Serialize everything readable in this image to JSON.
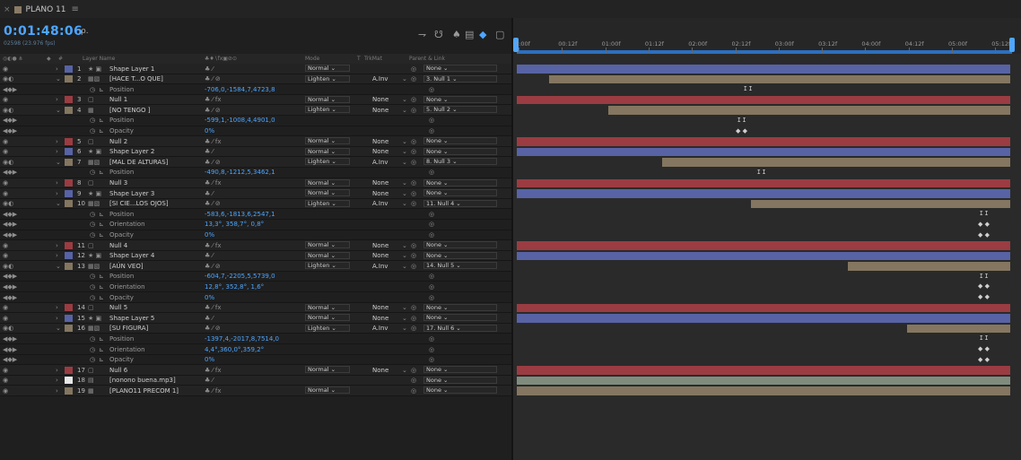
{
  "tab": {
    "close": "×",
    "name": "PLANO 11",
    "menu": "≡"
  },
  "timecode": "0:01:48:06",
  "frameinfo": "02598 (23.976 fps)",
  "search_icon": "ρ.",
  "columns": {
    "name": "Layer Name",
    "mode": "Mode",
    "t": "T",
    "trkmat": "TrkMat",
    "parent": "Parent & Link",
    "num": "#"
  },
  "ruler": [
    "0:00f",
    "00:12f",
    "01:00f",
    "01:12f",
    "02:00f",
    "02:12f",
    "03:00f",
    "03:12f",
    "04:00f",
    "04:12f",
    "05:00f",
    "05:12f"
  ],
  "colors": {
    "red": "#9b3c42",
    "blue": "#5763a5",
    "tan": "#847660",
    "gray": "#7a7a7a",
    "sage": "#7f8c7d",
    "white": "#e8e8e8",
    "accent": "#4da6ff"
  },
  "rows": [
    {
      "type": "layer",
      "num": "1",
      "lcolor": "#5763a5",
      "icon": "★ ▣",
      "name": "Shape Layer 1",
      "sw": "♣ ⁄",
      "mode": "Normal",
      "t": "",
      "trk": "",
      "parent": "None",
      "bar": "blue",
      "bs": 0
    },
    {
      "type": "layer",
      "num": "2",
      "lcolor": "#847660",
      "icon": "▦▧",
      "name": "[HACE T...O QUE]",
      "sw": "♣   ⁄         ⊘",
      "mode": "Lighten",
      "t": "",
      "trk": "A.Inv",
      "parent": "3. Null 1",
      "bar": "tan",
      "bs": 6.5,
      "exp": true
    },
    {
      "type": "prop",
      "name": "Position",
      "value": "-706,0,-1584,7,4723,8",
      "kf": "ⵊ  ⵊ"
    },
    {
      "type": "layer",
      "num": "3",
      "lcolor": "#9b3c42",
      "icon": "▢",
      "name": "Null 1",
      "sw": "♣  ⁄ fx",
      "mode": "Normal",
      "t": "",
      "trk": "None",
      "parent": "None",
      "bar": "red",
      "bs": 0
    },
    {
      "type": "layer",
      "num": "4",
      "lcolor": "#847660",
      "icon": "▦",
      "name": "[NO TENGO ]",
      "sw": "♣   ⁄         ⊘",
      "mode": "Lighten",
      "t": "",
      "trk": "None",
      "parent": "5. Null 2",
      "bar": "tan",
      "bs": 18.5,
      "exp": true
    },
    {
      "type": "prop",
      "name": "Position",
      "value": "-599,1,-1008,4,4901,0",
      "kf": "ⵊ  ⵊ"
    },
    {
      "type": "prop",
      "name": "Opacity",
      "value": "0%",
      "kf": "◆ ◆"
    },
    {
      "type": "layer",
      "num": "5",
      "lcolor": "#9b3c42",
      "icon": "▢",
      "name": "Null 2",
      "sw": "♣  ⁄ fx",
      "mode": "Normal",
      "t": "",
      "trk": "None",
      "parent": "None",
      "bar": "red",
      "bs": 0
    },
    {
      "type": "layer",
      "num": "6",
      "lcolor": "#5763a5",
      "icon": "★ ▣",
      "name": "Shape Layer 2",
      "sw": "♣ ⁄",
      "mode": "Normal",
      "t": "",
      "trk": "None",
      "parent": "None",
      "bar": "blue",
      "bs": 0
    },
    {
      "type": "layer",
      "num": "7",
      "lcolor": "#847660",
      "icon": "▦▧",
      "name": "[MAL DE ALTURAS]",
      "sw": "♣   ⁄         ⊘",
      "mode": "Lighten",
      "t": "",
      "trk": "A.Inv",
      "parent": "8. Null 3",
      "bar": "tan",
      "bs": 29.5,
      "exp": true
    },
    {
      "type": "prop",
      "name": "Position",
      "value": "-490,8,-1212,5,3462,1",
      "kf": "ⵊ  ⵊ"
    },
    {
      "type": "layer",
      "num": "8",
      "lcolor": "#9b3c42",
      "icon": "▢",
      "name": "Null 3",
      "sw": "♣  ⁄ fx",
      "mode": "Normal",
      "t": "",
      "trk": "None",
      "parent": "None",
      "bar": "red",
      "bs": 0
    },
    {
      "type": "layer",
      "num": "9",
      "lcolor": "#5763a5",
      "icon": "★ ▣",
      "name": "Shape Layer 3",
      "sw": "♣ ⁄",
      "mode": "Normal",
      "t": "",
      "trk": "None",
      "parent": "None",
      "bar": "blue",
      "bs": 0
    },
    {
      "type": "layer",
      "num": "10",
      "lcolor": "#847660",
      "icon": "▦▧",
      "name": "[SI CIE...LOS OJOS]",
      "sw": "♣   ⁄         ⊘",
      "mode": "Lighten",
      "t": "",
      "trk": "A.Inv",
      "parent": "11. Null 4",
      "bar": "tan",
      "bs": 47.5,
      "exp": true
    },
    {
      "type": "prop",
      "name": "Position",
      "value": "-583,6,-1813,6,2547,1",
      "kf": "ⵊ ⵊ"
    },
    {
      "type": "prop",
      "name": "Orientation",
      "value": "13,3°, 358,7°, 0,8°",
      "kf": "◆ ◆"
    },
    {
      "type": "prop",
      "name": "Opacity",
      "value": "0%",
      "kf": "◆ ◆"
    },
    {
      "type": "layer",
      "num": "11",
      "lcolor": "#9b3c42",
      "icon": "▢",
      "name": "Null 4",
      "sw": "♣  ⁄ fx",
      "mode": "Normal",
      "t": "",
      "trk": "None",
      "parent": "None",
      "bar": "red",
      "bs": 0
    },
    {
      "type": "layer",
      "num": "12",
      "lcolor": "#5763a5",
      "icon": "★ ▣",
      "name": "Shape Layer 4",
      "sw": "♣ ⁄",
      "mode": "Normal",
      "t": "",
      "trk": "None",
      "parent": "None",
      "bar": "blue",
      "bs": 0
    },
    {
      "type": "layer",
      "num": "13",
      "lcolor": "#847660",
      "icon": "▦▧",
      "name": "[AÚN VEO]",
      "sw": "♣   ⁄         ⊘",
      "mode": "Lighten",
      "t": "",
      "trk": "A.Inv",
      "parent": "14. Null 5",
      "bar": "tan",
      "bs": 67,
      "exp": true
    },
    {
      "type": "prop",
      "name": "Position",
      "value": "-604,7,-2205,5,5739,0",
      "kf": "ⵊ ⵊ"
    },
    {
      "type": "prop",
      "name": "Orientation",
      "value": "12,8°, 352,8°, 1,6°",
      "kf": "◆ ◆"
    },
    {
      "type": "prop",
      "name": "Opacity",
      "value": "0%",
      "kf": "◆ ◆"
    },
    {
      "type": "layer",
      "num": "14",
      "lcolor": "#9b3c42",
      "icon": "▢",
      "name": "Null 5",
      "sw": "♣  ⁄ fx",
      "mode": "Normal",
      "t": "",
      "trk": "None",
      "parent": "None",
      "bar": "red",
      "bs": 0
    },
    {
      "type": "layer",
      "num": "15",
      "lcolor": "#5763a5",
      "icon": "★ ▣",
      "name": "Shape Layer 5",
      "sw": "♣ ⁄",
      "mode": "Normal",
      "t": "",
      "trk": "None",
      "parent": "None",
      "bar": "blue",
      "bs": 0
    },
    {
      "type": "layer",
      "num": "16",
      "lcolor": "#847660",
      "icon": "▦▧",
      "name": "[SU FIGURA]",
      "sw": "♣   ⁄         ⊘",
      "mode": "Lighten",
      "t": "",
      "trk": "A.Inv",
      "parent": "17. Null 6",
      "bar": "tan",
      "bs": 79,
      "exp": true
    },
    {
      "type": "prop",
      "name": "Position",
      "value": "-1397,4,-2017,8,7514,0",
      "kf": "ⵊ ⵊ"
    },
    {
      "type": "prop",
      "name": "Orientation",
      "value": "4,4°,360,0°,359,2°",
      "kf": "◆ ◆"
    },
    {
      "type": "prop",
      "name": "Opacity",
      "value": "0%",
      "kf": "◆ ◆"
    },
    {
      "type": "layer",
      "num": "17",
      "lcolor": "#9b3c42",
      "icon": "▢",
      "name": "Null 6",
      "sw": "♣  ⁄ fx",
      "mode": "Normal",
      "t": "",
      "trk": "None",
      "parent": "None",
      "bar": "red",
      "bs": 0
    },
    {
      "type": "layer",
      "num": "18",
      "lcolor": "#e8e8e8",
      "icon": "▤",
      "name": "[nonono buena.mp3]",
      "sw": "♣ ⁄",
      "mode": "",
      "t": "",
      "trk": "",
      "parent": "None",
      "bar": "sage",
      "bs": 0
    },
    {
      "type": "layer",
      "num": "19",
      "lcolor": "#847660",
      "icon": "▦",
      "name": "[PLANO11 PRECOM 1]",
      "sw": "♣  ⁄ fx",
      "mode": "Normal",
      "t": "",
      "trk": "",
      "parent": "None",
      "bar": "tan",
      "bs": 0
    }
  ]
}
